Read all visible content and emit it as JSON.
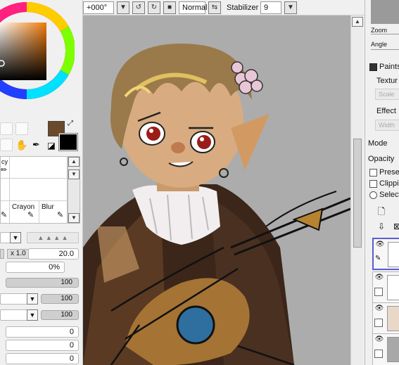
{
  "toolbar": {
    "rotation_value": "+000°",
    "blend_mode": "Normal",
    "stabilizer_label": "Stabilizer",
    "stabilizer_value": "9"
  },
  "left_panel": {
    "brush_labels": {
      "partial": "cy",
      "crayon": "Crayon",
      "blur": "Blur"
    },
    "size_multiplier": "x 1.0",
    "size_value": "20.0",
    "density_value": "0%",
    "rows": [
      {
        "value": "100"
      },
      {
        "value": "100"
      },
      {
        "value": "100"
      },
      {
        "value": "0"
      },
      {
        "value": "0"
      },
      {
        "value": "0"
      }
    ],
    "primary_color": "#6b4a2c",
    "secondary_color": "#000000"
  },
  "right_panel": {
    "zoom_label": "Zoom",
    "angle_label": "Angle",
    "paint_section_label": "Paints",
    "texture_label": "Textur",
    "scale_label": "Scale",
    "effect_label": "Effect",
    "width_label": "Width",
    "mode_label": "Mode",
    "opacity_label": "Opacity",
    "preserve_label": "Prese",
    "clipping_label": "Clippin",
    "selection_label": "Select"
  },
  "colors": {
    "canvas_bg": "#acacac",
    "panel_bg": "#f0f0f0",
    "selected_layer_border": "#5b5bd6"
  }
}
